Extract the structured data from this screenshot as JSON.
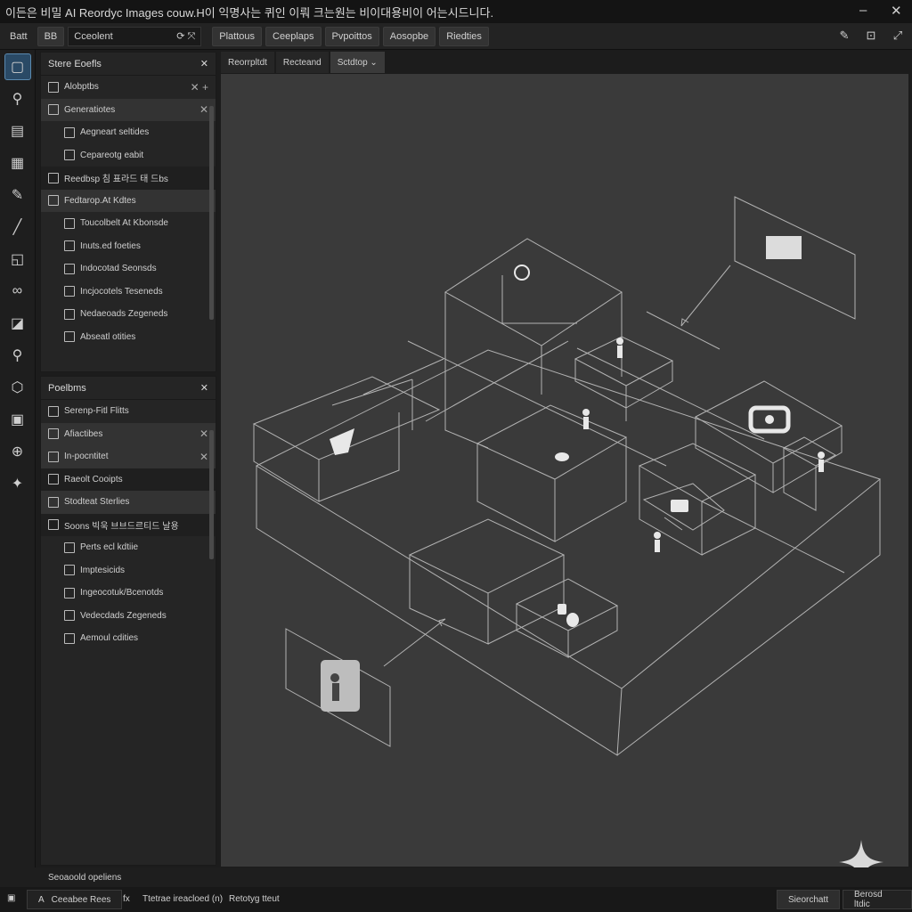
{
  "window": {
    "title": "이든은 비밀 AI Reordyc Images couw.H이 익명사는 퀴인 이뤄 크는원는 비이대용비이 어는시드니다.",
    "minimize_icon": "minimize-icon",
    "close_icon": "close-icon"
  },
  "toolbar": {
    "items": [
      "Batt",
      "BB"
    ],
    "search_value": "Cceolent",
    "tabs": [
      "Plattous",
      "Ceeplaps",
      "Pvpoittos",
      "Aosopbe",
      "Riedties"
    ]
  },
  "left_tools": [
    "select-tool",
    "node-tool",
    "layers-tool",
    "grid-tool",
    "pen-tool",
    "brush-tool",
    "frame-tool",
    "link-tool",
    "shape-tool",
    "zoom-tool",
    "transform-tool",
    "image-tool",
    "add-tool",
    "ai-tool"
  ],
  "panel1": {
    "title": "Stere Eoefls",
    "rows": [
      {
        "label": "Alobptbs",
        "indent": 1,
        "style": "",
        "close": true,
        "extra": "+"
      },
      {
        "label": "Generatiotes",
        "indent": 1,
        "style": "hl",
        "close": true
      },
      {
        "label": "Aegneart seltides",
        "indent": 2,
        "style": "",
        "close": false
      },
      {
        "label": "Cepareotg eabit",
        "indent": 2,
        "style": "",
        "close": false
      },
      {
        "label": "Reedbsp 침 표라드 태 드bs",
        "indent": 1,
        "style": "dk",
        "close": false
      },
      {
        "label": "Fedtarop.At Kdtes",
        "indent": 1,
        "style": "hl",
        "close": false
      },
      {
        "label": "Toucolbelt At Kbonsde",
        "indent": 2,
        "style": "",
        "close": false
      },
      {
        "label": "Inuts.ed foeties",
        "indent": 2,
        "style": "",
        "close": false
      },
      {
        "label": "Indocotad Seonsds",
        "indent": 2,
        "style": "",
        "close": false
      },
      {
        "label": "Incjocotels Teseneds",
        "indent": 2,
        "style": "",
        "close": false
      },
      {
        "label": "Nedaeoads Zegeneds",
        "indent": 2,
        "style": "",
        "close": false
      },
      {
        "label": "Abseatl otities",
        "indent": 2,
        "style": "",
        "close": false
      }
    ]
  },
  "panel2": {
    "title": "Poelbms",
    "rows": [
      {
        "label": "Serenp-Fitl Flitts",
        "indent": 1,
        "style": "",
        "close": false
      },
      {
        "label": "Afiactibes",
        "indent": 1,
        "style": "hl",
        "close": true
      },
      {
        "label": "In-pocntitet",
        "indent": 1,
        "style": "hl",
        "close": true
      },
      {
        "label": "Raeolt Cooipts",
        "indent": 1,
        "style": "dk",
        "close": false
      },
      {
        "label": "Stodteat Sterlies",
        "indent": 1,
        "style": "hl",
        "close": false
      },
      {
        "label": "Soons 빅욱 브브드르티드 날용",
        "indent": 1,
        "style": "dk",
        "close": false
      },
      {
        "label": "Perts ecl kdtiie",
        "indent": 2,
        "style": "",
        "close": false
      },
      {
        "label": "Imptesicids",
        "indent": 2,
        "style": "",
        "close": false
      },
      {
        "label": "Ingeocotuk/Bcenotds",
        "indent": 2,
        "style": "",
        "close": false
      },
      {
        "label": "Vedecdads Zegeneds",
        "indent": 2,
        "style": "",
        "close": false
      },
      {
        "label": "Aemoul cdities",
        "indent": 2,
        "style": "",
        "close": false
      }
    ]
  },
  "doc_tabs": [
    "Reorrpltdt",
    "Recteand",
    "Sctdtop"
  ],
  "active_tab": 2,
  "status": {
    "text": "Seoaoold opeliens"
  },
  "bottom": {
    "left_btn": "Ceeabee Rees",
    "mid_text": "Ttetrae ireacloed (n)",
    "mid_text2": "Retotyg tteut",
    "btn1": "Sieorchatt",
    "btn2": "Berosd ltdic"
  }
}
